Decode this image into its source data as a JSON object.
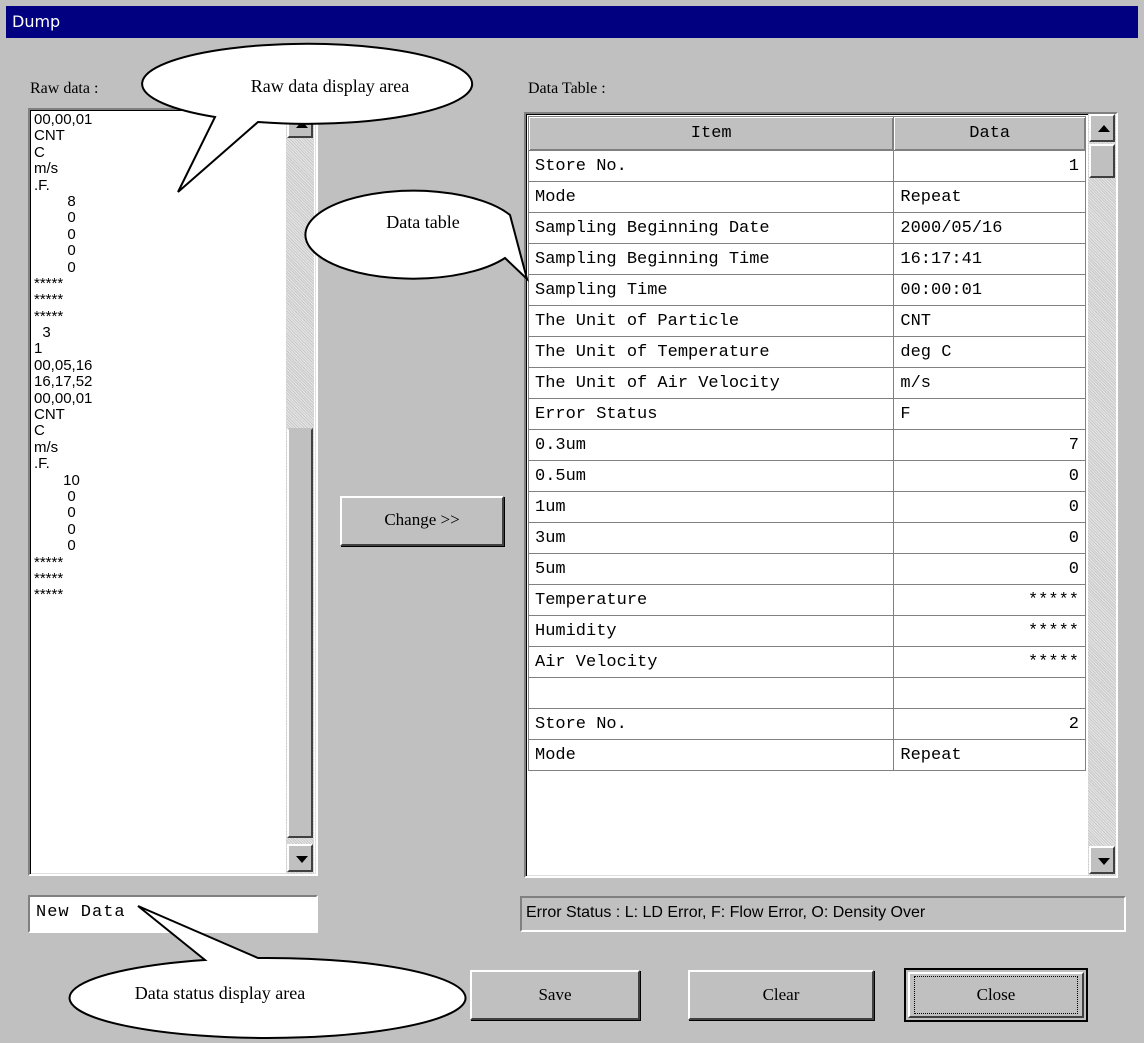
{
  "window": {
    "title": "Dump"
  },
  "raw": {
    "label": "Raw data :",
    "lines": [
      "00,00,01",
      "CNT",
      "C",
      "m/s",
      ".F.",
      "        8",
      "        0",
      "        0",
      "        0",
      "        0",
      "*****",
      "*****",
      "*****",
      "  3",
      "1",
      "00,05,16",
      "16,17,52",
      "00,00,01",
      "CNT",
      "C",
      "m/s",
      ".F.",
      "       10",
      "        0",
      "        0",
      "        0",
      "        0",
      "*****",
      "*****",
      "*****"
    ]
  },
  "change_button": "Change >>",
  "table": {
    "label": "Data Table :",
    "headers": [
      "Item",
      "Data"
    ],
    "rows": [
      [
        "Store No.",
        "1"
      ],
      [
        "Mode",
        "Repeat"
      ],
      [
        "Sampling Beginning Date",
        "2000/05/16"
      ],
      [
        "Sampling Beginning Time",
        "16:17:41"
      ],
      [
        "Sampling Time",
        "00:00:01"
      ],
      [
        "The Unit of Particle",
        "CNT"
      ],
      [
        "The Unit of Temperature",
        "deg C"
      ],
      [
        "The Unit of Air Velocity",
        "m/s"
      ],
      [
        "Error Status",
        "F"
      ],
      [
        "0.3um",
        "7"
      ],
      [
        "0.5um",
        "0"
      ],
      [
        "1um",
        "0"
      ],
      [
        "3um",
        "0"
      ],
      [
        "5um",
        "0"
      ],
      [
        "Temperature",
        "*****"
      ],
      [
        "Humidity",
        "*****"
      ],
      [
        "Air Velocity",
        "*****"
      ],
      [
        "",
        ""
      ],
      [
        "Store No.",
        "2"
      ],
      [
        "Mode",
        "Repeat"
      ]
    ]
  },
  "status_value": "New Data",
  "legend": "Error Status : L: LD Error, F: Flow Error, O: Density Over",
  "buttons": {
    "save": "Save",
    "clear": "Clear",
    "close": "Close"
  },
  "callouts": {
    "raw": "Raw data display area",
    "table": "Data table",
    "status": "Data status display area"
  }
}
